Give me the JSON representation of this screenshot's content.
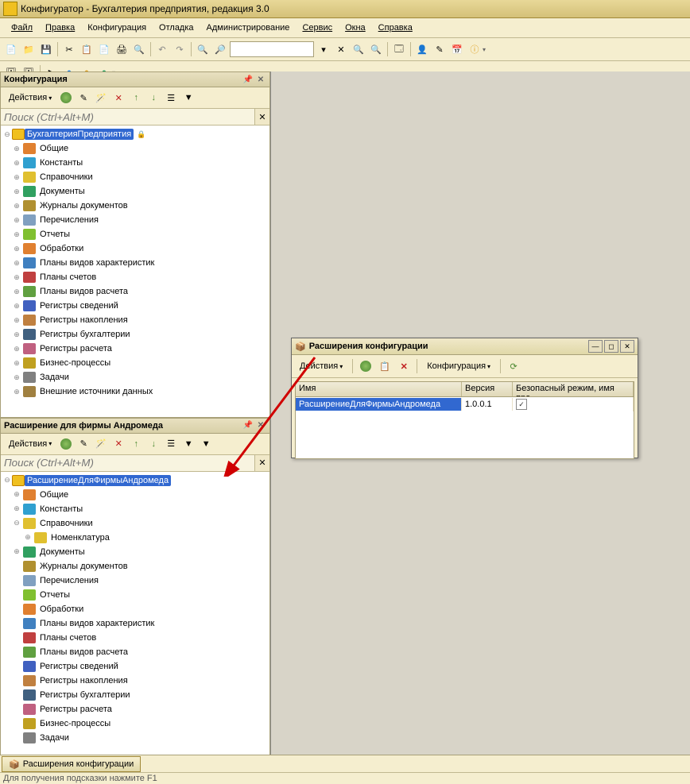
{
  "title": "Конфигуратор - Бухгалтерия предприятия, редакция 3.0",
  "menu": [
    "Файл",
    "Правка",
    "Конфигурация",
    "Отладка",
    "Администрирование",
    "Сервис",
    "Окна",
    "Справка"
  ],
  "panel1": {
    "title": "Конфигурация",
    "actions": "Действия",
    "search_placeholder": "Поиск (Ctrl+Alt+M)",
    "root": "БухгалтерияПредприятия",
    "nodes": [
      "Общие",
      "Константы",
      "Справочники",
      "Документы",
      "Журналы документов",
      "Перечисления",
      "Отчеты",
      "Обработки",
      "Планы видов характеристик",
      "Планы счетов",
      "Планы видов расчета",
      "Регистры сведений",
      "Регистры накопления",
      "Регистры бухгалтерии",
      "Регистры расчета",
      "Бизнес-процессы",
      "Задачи",
      "Внешние источники данных"
    ]
  },
  "panel2": {
    "title": "Расширение для фирмы Андромеда",
    "actions": "Действия",
    "search_placeholder": "Поиск (Ctrl+Alt+M)",
    "root": "РасширениеДляФирмыАндромеда",
    "nodes": [
      "Общие",
      "Константы",
      "Справочники",
      "Документы",
      "Журналы документов",
      "Перечисления",
      "Отчеты",
      "Обработки",
      "Планы видов характеристик",
      "Планы счетов",
      "Планы видов расчета",
      "Регистры сведений",
      "Регистры накопления",
      "Регистры бухгалтерии",
      "Регистры расчета",
      "Бизнес-процессы",
      "Задачи"
    ],
    "subnode": "Номенклатура"
  },
  "child_window": {
    "title": "Расширения конфигурации",
    "actions": "Действия",
    "config": "Конфигурация",
    "cols": [
      "Имя",
      "Версия",
      "Безопасный режим, имя про..."
    ],
    "row": {
      "name": "РасширениеДляФирмыАндромеда",
      "version": "1.0.0.1",
      "safe": "✓"
    }
  },
  "taskbar": {
    "btn": "Расширения конфигурации"
  },
  "status": "Для получения подсказки нажмите F1"
}
